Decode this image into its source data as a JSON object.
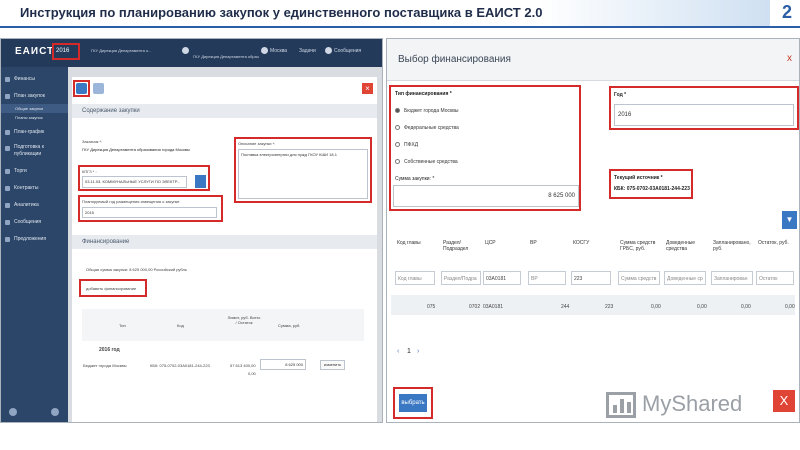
{
  "slide": {
    "title": "Инструкция по планированию  закупок у единственного поставщика в ЕАИСТ 2.0",
    "number": "2"
  },
  "left": {
    "topbar": {
      "logo": "ЕАИСТ",
      "year": "2016",
      "org1": "ГКУ Дирекция Департамента о...",
      "org2": "ГКУ Дирекция Департамента образ",
      "item1": "Москва",
      "item2": "Задачи",
      "item3": "Сообщения"
    },
    "sidebar": [
      "Финансы",
      "План закупок",
      "План-график",
      "Подготовка к публикации",
      "Торги",
      "Контракты",
      "Аналитика",
      "Сообщения",
      "Предложения"
    ],
    "sidebar_sub": [
      "Общие закупки",
      "Планы закупок"
    ],
    "content": {
      "section1": "Содержание закупки",
      "customer_label": "Заказчик *:",
      "customer_value": "ГКУ Дирекция Департамента образования города Москвы",
      "kpgz_label": "КПГЗ * :",
      "kpgz_value": "03.11.03. КОММУНАЛЬНЫЕ УСЛУГИ ПО ЭЛЕКТР...",
      "desc_label": "Описание закупки *:",
      "desc_value": "Поставка электроэнергии для нужд ГКОУ КШИ 18.1",
      "period_label": "Планируемый год размещения извещения о закупке",
      "period_value": "2015",
      "section2": "Финансирование",
      "total_text": "Общая сумма закупки: 8 625 000,00 Российский рубль",
      "add_financing": "добавить финансирование",
      "th_type": "Тип",
      "th_code": "Код",
      "th_limit": "Лимит, руб. Всего / Остаток",
      "th_sum": "Сумма, руб.",
      "year_row": "2016 год",
      "row_type": "Бюджет города Москвы",
      "row_code": "КБК: 075-0702-03А0181-244-223",
      "row_limit": "57 613 400,00",
      "row_rest": "0,00",
      "row_sum": "8 625 000",
      "row_btn": "изменить"
    }
  },
  "modal": {
    "title": "Выбор финансирования",
    "close": "x",
    "type_label": "Тип финансирования *",
    "types": [
      "Бюджет города Москвы",
      "Федеральные средства",
      "ПФХД",
      "Собственные средства"
    ],
    "selected_type_index": 0,
    "sum_label": "Сумма закупки: *",
    "sum_value": "8 625 000",
    "year_label": "Год *",
    "year_value": "2016",
    "source_label": "Текущий источник *",
    "source_value": "КБК: 075-0702-03А0181-244-223",
    "columns": [
      "Код главы",
      "Раздел/ Подраздел",
      "ЦСР",
      "ВР",
      "КОСГУ",
      "Сумма средств ГРБС, руб.",
      "Доведенные средства",
      "Запланировано, руб.",
      "Остаток, руб."
    ],
    "filters": [
      "Код главы",
      "Раздел/Подра",
      "03А0181",
      "ВР",
      "223",
      "Сумма средств",
      "Доведенные ср",
      "Запланирован",
      "Остаток"
    ],
    "row": [
      "075",
      "0702",
      "03А0181",
      "244",
      "223",
      "0,00",
      "0,00",
      "0,00",
      "0,00"
    ],
    "page": "1",
    "choose_btn": "выбрать"
  },
  "watermark": {
    "text": "MyShared",
    "close": "X"
  },
  "colors": {
    "accent": "#3b78c4",
    "highlight": "#d42a2a",
    "sidebar": "#2c4669",
    "topbar": "#233a5a"
  }
}
